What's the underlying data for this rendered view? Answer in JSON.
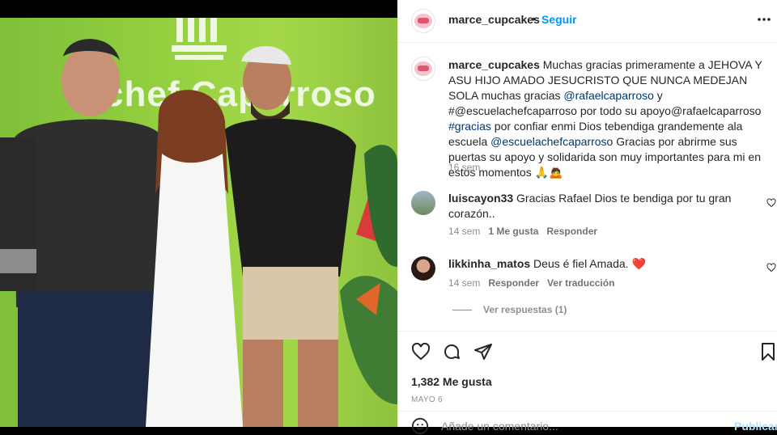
{
  "post": {
    "username": "marce_cupcakes",
    "follow_label": "Seguir",
    "separator": "•"
  },
  "photo": {
    "sign_text": "chef Caparroso"
  },
  "caption": {
    "username": "marce_cupcakes",
    "text_1": " Muchas gracias primeramente a JEHOVA Y ASU HIJO AMADO JESUCRISTO QUE NUNCA MEDEJAN SOLA muchas gracias ",
    "mention_1": "@rafaelcaparroso",
    "text_2": " y #@escuelachefcaparroso por todo su apoyo@rafaelcaparroso ",
    "hashtag": "#gracias",
    "text_3": " por confiar enmi Dios tebendiga grandemente ala escuela ",
    "mention_2": "@escuelachefcaparroso",
    "text_4": " Gracias por abrirme sus puertas su apoyo y solidarida son muy importantes para mi en estos momentos 🙏🙇",
    "time": "16 sem"
  },
  "comments": [
    {
      "username": "luiscayon33",
      "text": " Gracias Rafael Dios te bendiga por tu gran corazón..",
      "time": "14 sem",
      "likes": "1 Me gusta",
      "reply": "Responder"
    },
    {
      "username": "likkinha_matos",
      "text": " Deus é fiel Amada. ❤️",
      "time": "14 sem",
      "reply": "Responder",
      "translate": "Ver traducción"
    }
  ],
  "view_replies": "Ver respuestas (1)",
  "likes_count": "1,382 Me gusta",
  "date": "MAYO 6",
  "add_comment": {
    "placeholder": "Añade un comentario...",
    "publish": "Publicar"
  },
  "colors": {
    "accent": "#0095f6",
    "link": "#00376b",
    "heart_red": "#ed4956"
  }
}
